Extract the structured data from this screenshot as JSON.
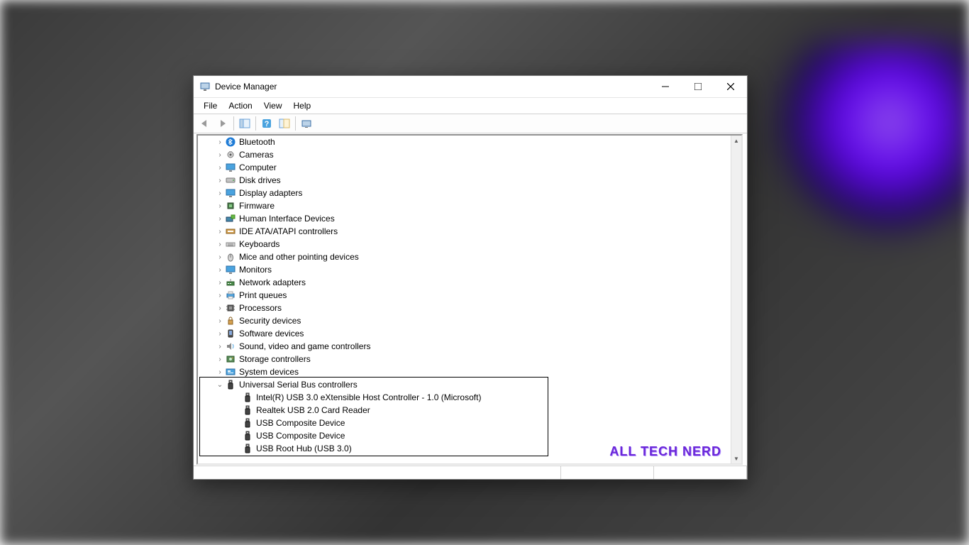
{
  "window": {
    "title": "Device Manager"
  },
  "menu": {
    "file": "File",
    "action": "Action",
    "view": "View",
    "help": "Help"
  },
  "tree": {
    "items": [
      {
        "label": "Bluetooth",
        "icon": "bluetooth",
        "expanded": false
      },
      {
        "label": "Cameras",
        "icon": "camera",
        "expanded": false
      },
      {
        "label": "Computer",
        "icon": "monitor",
        "expanded": false
      },
      {
        "label": "Disk drives",
        "icon": "disk",
        "expanded": false
      },
      {
        "label": "Display adapters",
        "icon": "monitor",
        "expanded": false
      },
      {
        "label": "Firmware",
        "icon": "chip",
        "expanded": false
      },
      {
        "label": "Human Interface Devices",
        "icon": "hid",
        "expanded": false
      },
      {
        "label": "IDE ATA/ATAPI controllers",
        "icon": "ide",
        "expanded": false
      },
      {
        "label": "Keyboards",
        "icon": "keyboard",
        "expanded": false
      },
      {
        "label": "Mice and other pointing devices",
        "icon": "mouse",
        "expanded": false
      },
      {
        "label": "Monitors",
        "icon": "monitor",
        "expanded": false
      },
      {
        "label": "Network adapters",
        "icon": "network",
        "expanded": false
      },
      {
        "label": "Print queues",
        "icon": "printer",
        "expanded": false
      },
      {
        "label": "Processors",
        "icon": "cpu",
        "expanded": false
      },
      {
        "label": "Security devices",
        "icon": "security",
        "expanded": false
      },
      {
        "label": "Software devices",
        "icon": "software",
        "expanded": false
      },
      {
        "label": "Sound, video and game controllers",
        "icon": "sound",
        "expanded": false
      },
      {
        "label": "Storage controllers",
        "icon": "storage",
        "expanded": false
      },
      {
        "label": "System devices",
        "icon": "system",
        "expanded": false
      },
      {
        "label": "Universal Serial Bus controllers",
        "icon": "usb",
        "expanded": true,
        "children": [
          {
            "label": "Intel(R) USB 3.0 eXtensible Host Controller - 1.0 (Microsoft)",
            "icon": "usb"
          },
          {
            "label": "Realtek USB 2.0 Card Reader",
            "icon": "usb"
          },
          {
            "label": "USB Composite Device",
            "icon": "usb"
          },
          {
            "label": "USB Composite Device",
            "icon": "usb"
          },
          {
            "label": "USB Root Hub (USB 3.0)",
            "icon": "usb"
          }
        ]
      }
    ]
  },
  "watermark": "ALL TECH NERD"
}
